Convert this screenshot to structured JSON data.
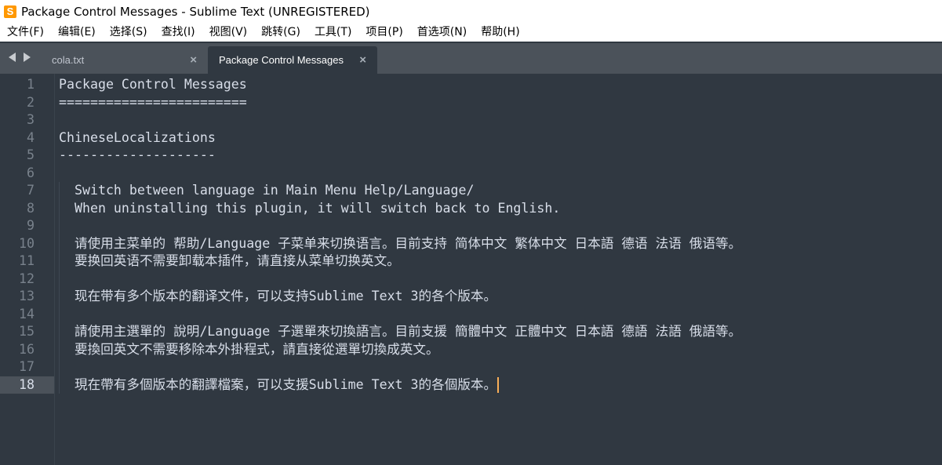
{
  "window": {
    "title": "Package Control Messages - Sublime Text (UNREGISTERED)",
    "app_icon_glyph": "S"
  },
  "menu": [
    "文件(F)",
    "编辑(E)",
    "选择(S)",
    "查找(I)",
    "视图(V)",
    "跳转(G)",
    "工具(T)",
    "项目(P)",
    "首选项(N)",
    "帮助(H)"
  ],
  "tabs": [
    {
      "label": "cola.txt",
      "close": "×",
      "active": false
    },
    {
      "label": "Package Control Messages",
      "close": "×",
      "active": true
    }
  ],
  "editor": {
    "current_line": 18,
    "cursor_color": "#f9ae58",
    "lines": [
      "Package Control Messages",
      "========================",
      "",
      "ChineseLocalizations",
      "--------------------",
      "",
      "  Switch between language in Main Menu Help/Language/",
      "  When uninstalling this plugin, it will switch back to English.",
      "",
      "  请使用主菜单的 帮助/Language 子菜单来切换语言。目前支持 简体中文 繁体中文 日本語 德语 法语 俄语等。",
      "  要换回英语不需要卸载本插件，请直接从菜单切换英文。",
      "",
      "  现在带有多个版本的翻译文件，可以支持Sublime Text 3的各个版本。",
      "",
      "  請使用主選單的 說明/Language 子選單來切換語言。目前支援 簡體中文 正體中文 日本語 德語 法語 俄語等。",
      "  要換回英文不需要移除本外掛程式，請直接從選單切換成英文。",
      "",
      "  現在帶有多個版本的翻譯檔案，可以支援Sublime Text 3的各個版本。"
    ]
  },
  "colors": {
    "editor_bg": "#303841",
    "tabbar_bg": "#4b525a",
    "text": "#d8dee9",
    "line_numbers": "#79828c",
    "accent": "#ff9800"
  }
}
